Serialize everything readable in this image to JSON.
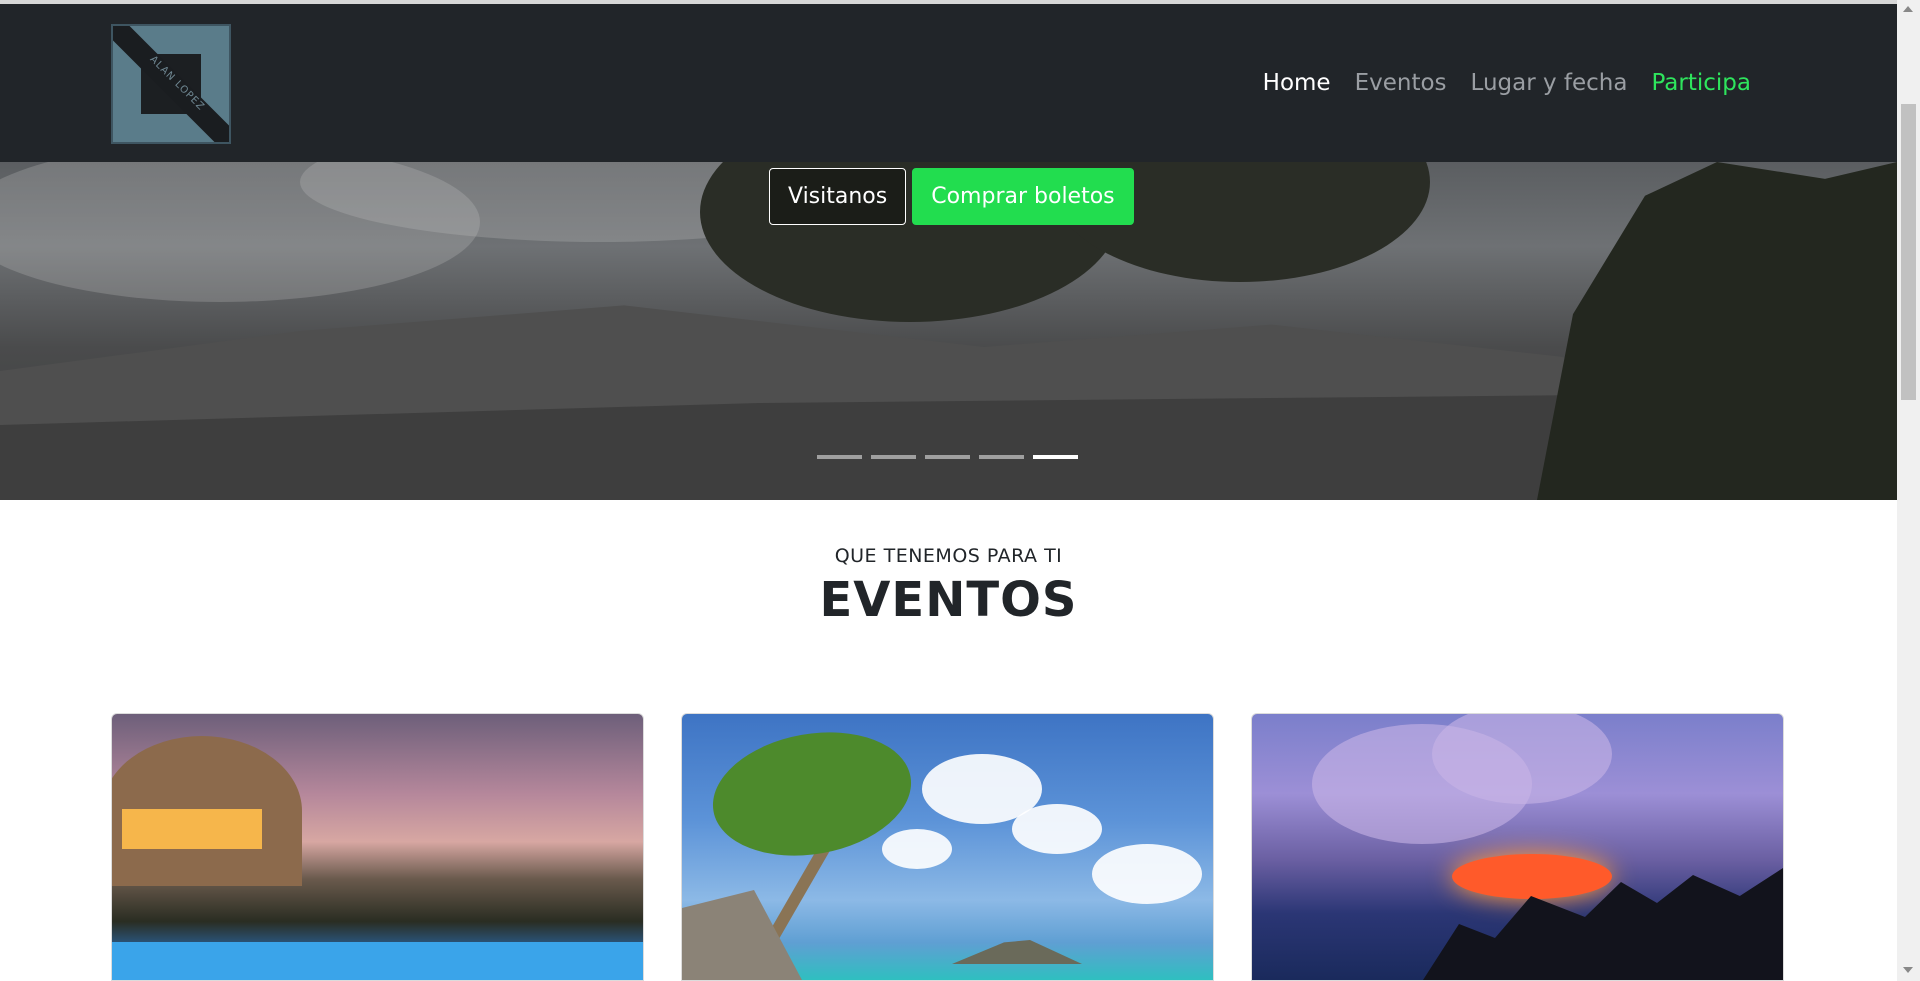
{
  "nav": {
    "logo_text": "ALAN LOPEZ",
    "items": [
      {
        "label": "Home",
        "state": "active"
      },
      {
        "label": "Eventos",
        "state": "default"
      },
      {
        "label": "Lugar y fecha",
        "state": "default"
      },
      {
        "label": "Participa",
        "state": "accent"
      }
    ]
  },
  "hero": {
    "buttons": {
      "visit": "Visitanos",
      "buy": "Comprar boletos"
    },
    "carousel": {
      "slides": 5,
      "active_index": 4
    }
  },
  "section": {
    "subtitle": "QUE TENEMOS PARA TI",
    "title": "EVENTOS"
  },
  "cards": [
    {
      "image": "resort-dusk-image"
    },
    {
      "image": "palm-beach-image"
    },
    {
      "image": "lava-ocean-image"
    }
  ],
  "colors": {
    "navbar": "#212529",
    "accent_green": "#22dd4f",
    "nav_inactive": "#9a9ea3"
  }
}
